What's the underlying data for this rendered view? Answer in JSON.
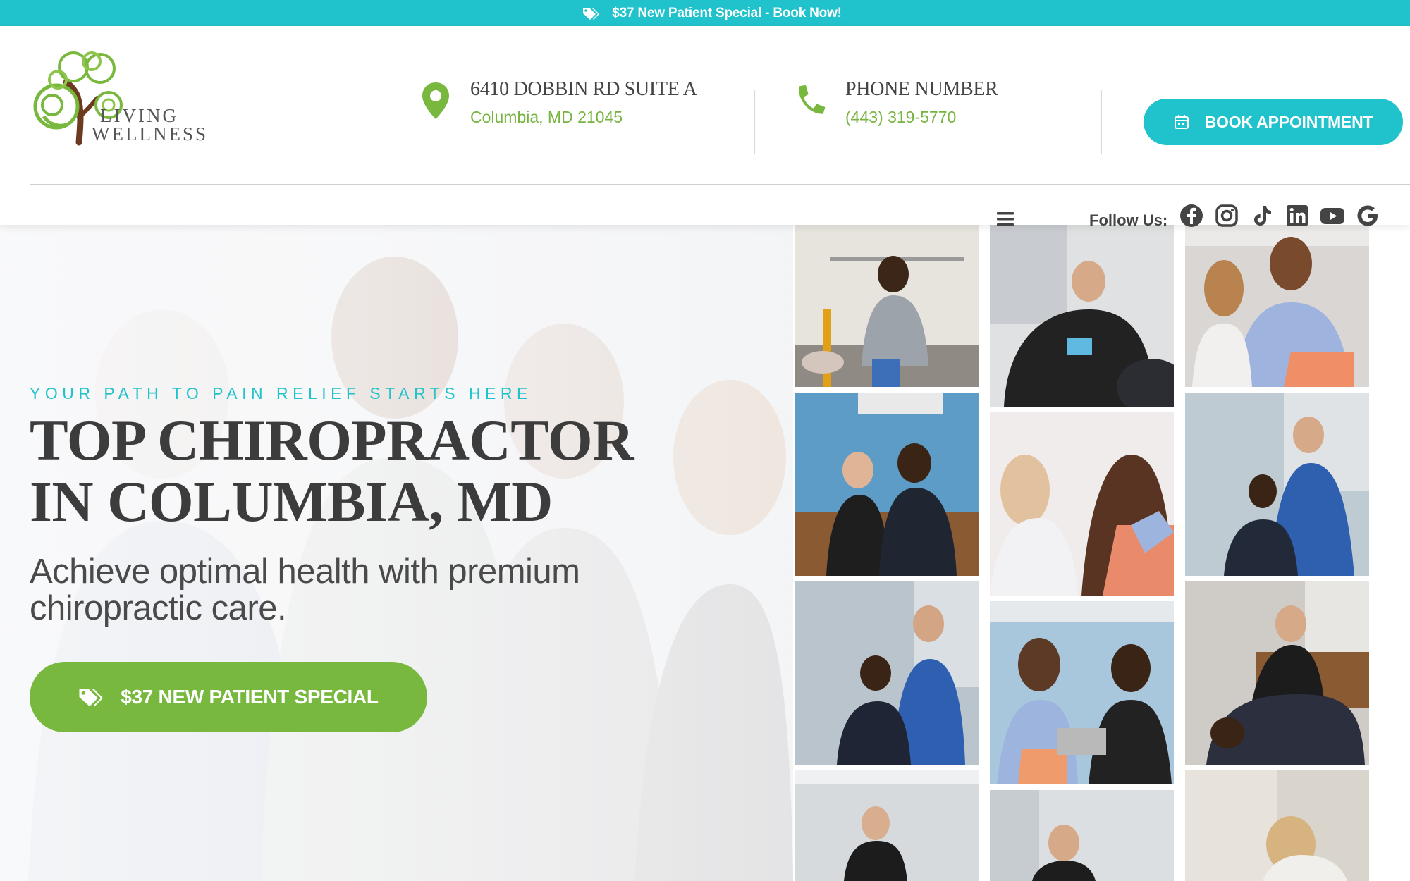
{
  "promo": {
    "text": "$37 New Patient Special - Book Now!",
    "icon": "tags-icon"
  },
  "logo": {
    "line1": "LIVING",
    "line2": "WELLNESS",
    "icon": "tree-logo"
  },
  "address": {
    "title": "6410 DOBBIN RD SUITE A",
    "sub": "Columbia, MD 21045",
    "icon": "map-pin-icon"
  },
  "phone": {
    "title": "PHONE NUMBER",
    "sub": "(443) 319-5770",
    "icon": "phone-icon"
  },
  "book": {
    "label": "BOOK APPOINTMENT",
    "icon": "calendar-icon"
  },
  "nav": {
    "menu_icon": "hamburger-menu-icon",
    "follow_label": "Follow Us:"
  },
  "social": [
    "facebook-icon",
    "instagram-icon",
    "tiktok-icon",
    "linkedin-icon",
    "youtube-icon",
    "google-icon"
  ],
  "hero": {
    "eyebrow": "YOUR PATH TO PAIN RELIEF STARTS HERE",
    "title_line1": "TOP CHIROPRACTOR",
    "title_line2": "IN COLUMBIA, MD",
    "subtitle": "Achieve optimal health with premium chiropractic care.",
    "cta": "$37 NEW PATIENT SPECIAL"
  },
  "colors": {
    "teal": "#20c2cb",
    "green": "#78b83e",
    "text": "#3c3c3c"
  }
}
